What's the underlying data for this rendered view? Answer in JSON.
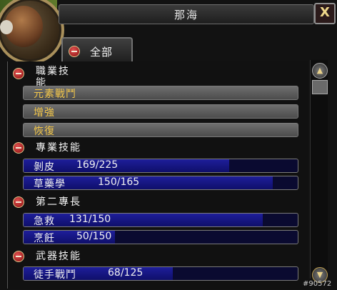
{
  "window": {
    "title": "那海",
    "close_label": "X"
  },
  "tab": {
    "label": "全部"
  },
  "categories": [
    {
      "label": "職業技能",
      "skills": [
        {
          "name": "元素戰鬥"
        },
        {
          "name": "增強"
        },
        {
          "name": "恢復"
        }
      ]
    },
    {
      "label": "專業技能",
      "skills": [
        {
          "name": "剝皮",
          "rank": "169/225",
          "fraction": 0.751
        },
        {
          "name": "草藥學",
          "rank": "150/165",
          "fraction": 0.909
        }
      ]
    },
    {
      "label": "第二專長",
      "skills": [
        {
          "name": "急救",
          "rank": "131/150",
          "fraction": 0.873
        },
        {
          "name": "烹飪",
          "rank": "50/150",
          "fraction": 0.333
        }
      ]
    },
    {
      "label": "武器技能",
      "skills": [
        {
          "name": "徒手戰鬥",
          "rank": "68/125",
          "fraction": 0.544
        }
      ]
    }
  ],
  "scroll": {
    "up_icon": "▲",
    "down_icon": "▼"
  },
  "watermark": "#90572"
}
